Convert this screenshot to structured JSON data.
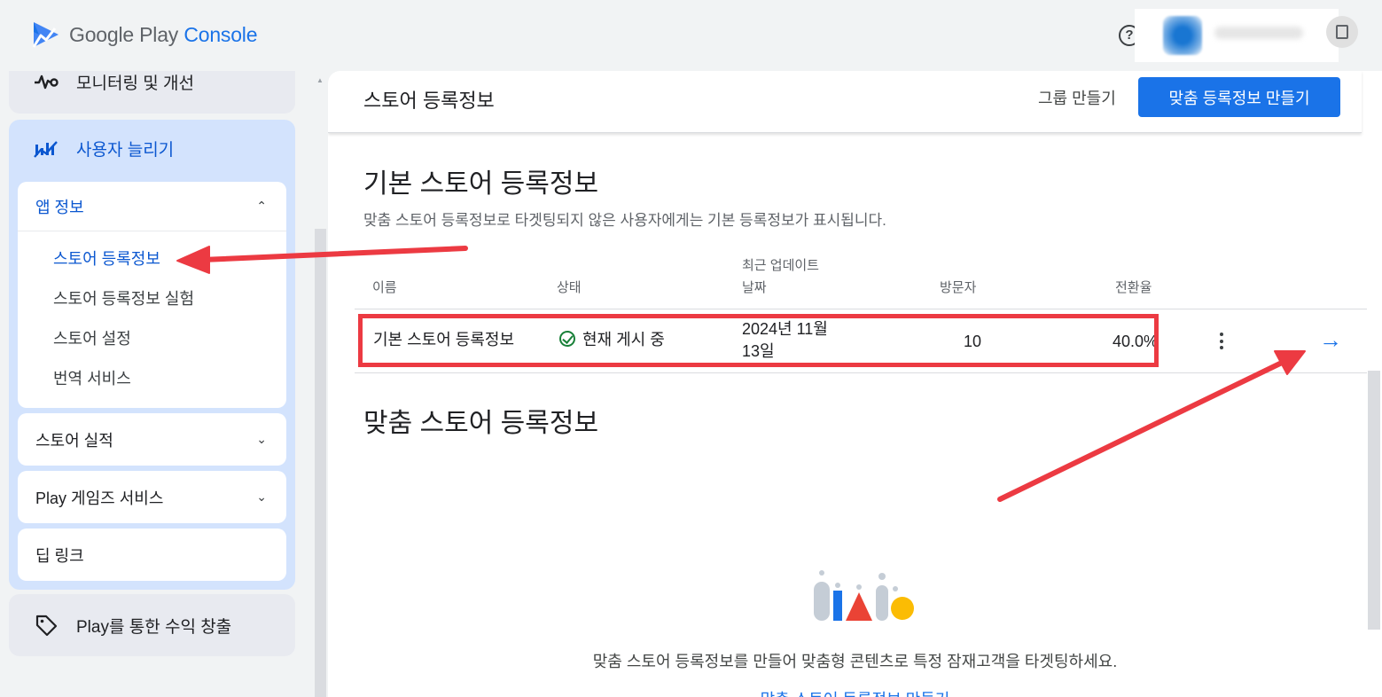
{
  "app": {
    "logo_primary": "Google Play",
    "logo_secondary": "Console",
    "help_glyph": "?"
  },
  "sidebar": {
    "monitoring_label": "모니터링 및 개선",
    "grow_label": "사용자 늘리기",
    "app_info": {
      "label": "앱 정보",
      "items": [
        "스토어 등록정보",
        "스토어 등록정보 실험",
        "스토어 설정",
        "번역 서비스"
      ]
    },
    "store_performance_label": "스토어 실적",
    "play_games_label": "Play 게임즈 서비스",
    "deep_links_label": "딥 링크",
    "monetize_label": "Play를 통한 수익 창출"
  },
  "main": {
    "page_title": "스토어 등록정보",
    "create_group_label": "그룹 만들기",
    "create_custom_label": "맞춤 등록정보 만들기",
    "default_section": {
      "title": "기본 스토어 등록정보",
      "description": "맞춤 스토어 등록정보로 타겟팅되지 않은 사용자에게는 기본 등록정보가 표시됩니다.",
      "columns": {
        "name": "이름",
        "status": "상태",
        "updated_line1": "최근 업데이트",
        "updated_line2": "날짜",
        "visitors": "방문자",
        "conversion": "전환율"
      },
      "row": {
        "name": "기본 스토어 등록정보",
        "status": "현재 게시 중",
        "updated_line1": "2024년 11월",
        "updated_line2": "13일",
        "visitors": "10",
        "conversion": "40.0%"
      }
    },
    "custom_section": {
      "title": "맞춤 스토어 등록정보",
      "empty_text": "맞춤 스토어 등록정보를 만들어 맞춤형 콘텐츠로 특정 잠재고객을 타겟팅하세요.",
      "empty_link": "맞춤 스토어 등록정보 만들기"
    }
  },
  "colors": {
    "accent": "#1a73e8",
    "annotation_red": "#ec3a42",
    "status_green": "#188038"
  }
}
